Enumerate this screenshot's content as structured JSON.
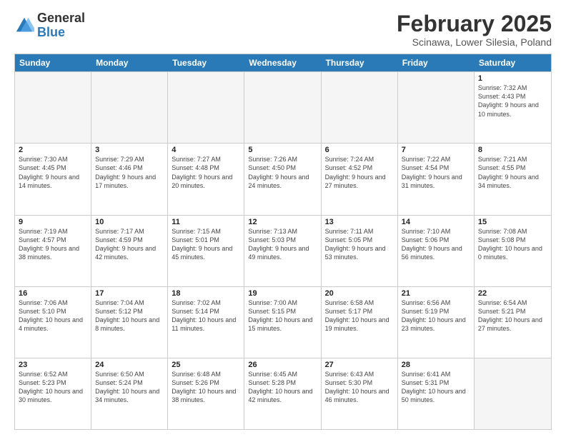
{
  "logo": {
    "general": "General",
    "blue": "Blue"
  },
  "header": {
    "month": "February 2025",
    "location": "Scinawa, Lower Silesia, Poland"
  },
  "days": [
    "Sunday",
    "Monday",
    "Tuesday",
    "Wednesday",
    "Thursday",
    "Friday",
    "Saturday"
  ],
  "rows": [
    [
      {
        "day": "",
        "info": ""
      },
      {
        "day": "",
        "info": ""
      },
      {
        "day": "",
        "info": ""
      },
      {
        "day": "",
        "info": ""
      },
      {
        "day": "",
        "info": ""
      },
      {
        "day": "",
        "info": ""
      },
      {
        "day": "1",
        "info": "Sunrise: 7:32 AM\nSunset: 4:43 PM\nDaylight: 9 hours and 10 minutes."
      }
    ],
    [
      {
        "day": "2",
        "info": "Sunrise: 7:30 AM\nSunset: 4:45 PM\nDaylight: 9 hours and 14 minutes."
      },
      {
        "day": "3",
        "info": "Sunrise: 7:29 AM\nSunset: 4:46 PM\nDaylight: 9 hours and 17 minutes."
      },
      {
        "day": "4",
        "info": "Sunrise: 7:27 AM\nSunset: 4:48 PM\nDaylight: 9 hours and 20 minutes."
      },
      {
        "day": "5",
        "info": "Sunrise: 7:26 AM\nSunset: 4:50 PM\nDaylight: 9 hours and 24 minutes."
      },
      {
        "day": "6",
        "info": "Sunrise: 7:24 AM\nSunset: 4:52 PM\nDaylight: 9 hours and 27 minutes."
      },
      {
        "day": "7",
        "info": "Sunrise: 7:22 AM\nSunset: 4:54 PM\nDaylight: 9 hours and 31 minutes."
      },
      {
        "day": "8",
        "info": "Sunrise: 7:21 AM\nSunset: 4:55 PM\nDaylight: 9 hours and 34 minutes."
      }
    ],
    [
      {
        "day": "9",
        "info": "Sunrise: 7:19 AM\nSunset: 4:57 PM\nDaylight: 9 hours and 38 minutes."
      },
      {
        "day": "10",
        "info": "Sunrise: 7:17 AM\nSunset: 4:59 PM\nDaylight: 9 hours and 42 minutes."
      },
      {
        "day": "11",
        "info": "Sunrise: 7:15 AM\nSunset: 5:01 PM\nDaylight: 9 hours and 45 minutes."
      },
      {
        "day": "12",
        "info": "Sunrise: 7:13 AM\nSunset: 5:03 PM\nDaylight: 9 hours and 49 minutes."
      },
      {
        "day": "13",
        "info": "Sunrise: 7:11 AM\nSunset: 5:05 PM\nDaylight: 9 hours and 53 minutes."
      },
      {
        "day": "14",
        "info": "Sunrise: 7:10 AM\nSunset: 5:06 PM\nDaylight: 9 hours and 56 minutes."
      },
      {
        "day": "15",
        "info": "Sunrise: 7:08 AM\nSunset: 5:08 PM\nDaylight: 10 hours and 0 minutes."
      }
    ],
    [
      {
        "day": "16",
        "info": "Sunrise: 7:06 AM\nSunset: 5:10 PM\nDaylight: 10 hours and 4 minutes."
      },
      {
        "day": "17",
        "info": "Sunrise: 7:04 AM\nSunset: 5:12 PM\nDaylight: 10 hours and 8 minutes."
      },
      {
        "day": "18",
        "info": "Sunrise: 7:02 AM\nSunset: 5:14 PM\nDaylight: 10 hours and 11 minutes."
      },
      {
        "day": "19",
        "info": "Sunrise: 7:00 AM\nSunset: 5:15 PM\nDaylight: 10 hours and 15 minutes."
      },
      {
        "day": "20",
        "info": "Sunrise: 6:58 AM\nSunset: 5:17 PM\nDaylight: 10 hours and 19 minutes."
      },
      {
        "day": "21",
        "info": "Sunrise: 6:56 AM\nSunset: 5:19 PM\nDaylight: 10 hours and 23 minutes."
      },
      {
        "day": "22",
        "info": "Sunrise: 6:54 AM\nSunset: 5:21 PM\nDaylight: 10 hours and 27 minutes."
      }
    ],
    [
      {
        "day": "23",
        "info": "Sunrise: 6:52 AM\nSunset: 5:23 PM\nDaylight: 10 hours and 30 minutes."
      },
      {
        "day": "24",
        "info": "Sunrise: 6:50 AM\nSunset: 5:24 PM\nDaylight: 10 hours and 34 minutes."
      },
      {
        "day": "25",
        "info": "Sunrise: 6:48 AM\nSunset: 5:26 PM\nDaylight: 10 hours and 38 minutes."
      },
      {
        "day": "26",
        "info": "Sunrise: 6:45 AM\nSunset: 5:28 PM\nDaylight: 10 hours and 42 minutes."
      },
      {
        "day": "27",
        "info": "Sunrise: 6:43 AM\nSunset: 5:30 PM\nDaylight: 10 hours and 46 minutes."
      },
      {
        "day": "28",
        "info": "Sunrise: 6:41 AM\nSunset: 5:31 PM\nDaylight: 10 hours and 50 minutes."
      },
      {
        "day": "",
        "info": ""
      }
    ]
  ]
}
